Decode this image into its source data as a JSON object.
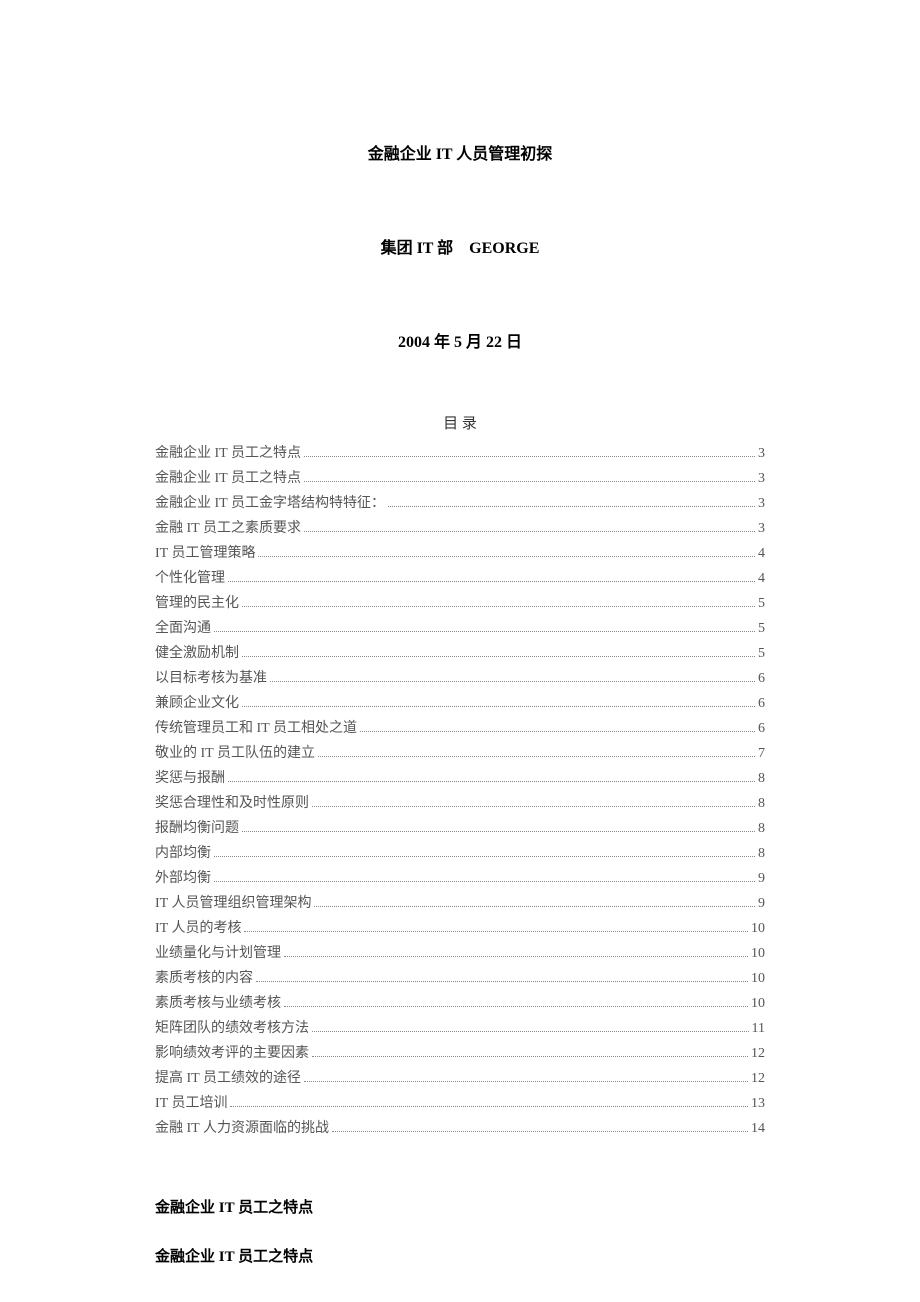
{
  "title": "金融企业 IT 人员管理初探",
  "subtitle": "集团 IT 部　GEORGE",
  "date": "2004 年 5 月 22 日",
  "toc_header": "目 录",
  "toc": [
    {
      "label": "金融企业 IT 员工之特点",
      "page": "3"
    },
    {
      "label": "金融企业 IT 员工之特点",
      "page": "3"
    },
    {
      "label": "金融企业 IT 员工金字塔结构特特征：",
      "page": "3"
    },
    {
      "label": "金融 IT 员工之素质要求",
      "page": "3"
    },
    {
      "label": "IT 员工管理策略",
      "page": "4"
    },
    {
      "label": "个性化管理",
      "page": "4"
    },
    {
      "label": "管理的民主化",
      "page": "5"
    },
    {
      "label": "全面沟通",
      "page": "5"
    },
    {
      "label": "健全激励机制",
      "page": "5"
    },
    {
      "label": "以目标考核为基准",
      "page": "6"
    },
    {
      "label": "兼顾企业文化",
      "page": "6"
    },
    {
      "label": "传统管理员工和 IT 员工相处之道",
      "page": "6"
    },
    {
      "label": "敬业的 IT 员工队伍的建立",
      "page": "7"
    },
    {
      "label": "奖惩与报酬",
      "page": "8"
    },
    {
      "label": "奖惩合理性和及时性原则",
      "page": "8"
    },
    {
      "label": "报酬均衡问题",
      "page": "8"
    },
    {
      "label": "内部均衡",
      "page": "8"
    },
    {
      "label": "外部均衡",
      "page": "9"
    },
    {
      "label": "IT 人员管理组织管理架构",
      "page": "9"
    },
    {
      "label": "IT 人员的考核",
      "page": "10"
    },
    {
      "label": "业绩量化与计划管理",
      "page": "10"
    },
    {
      "label": "素质考核的内容",
      "page": "10"
    },
    {
      "label": "素质考核与业绩考核",
      "page": "10"
    },
    {
      "label": "矩阵团队的绩效考核方法",
      "page": "11"
    },
    {
      "label": "影响绩效考评的主要因素",
      "page": "12"
    },
    {
      "label": "提高 IT 员工绩效的途径",
      "page": "12"
    },
    {
      "label": "IT 员工培训",
      "page": "13"
    },
    {
      "label": "金融 IT 人力资源面临的挑战",
      "page": "14"
    }
  ],
  "section1": "金融企业 IT 员工之特点",
  "section2": "金融企业 IT 员工之特点"
}
